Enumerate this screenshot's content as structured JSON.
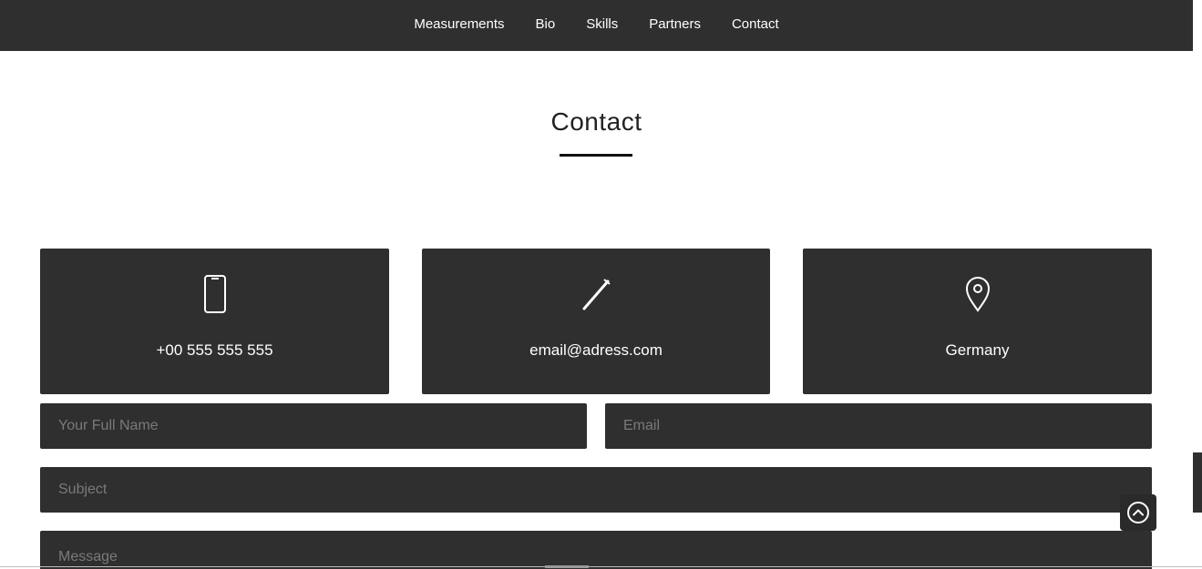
{
  "nav": {
    "items": [
      {
        "label": "Measurements"
      },
      {
        "label": "Bio"
      },
      {
        "label": "Skills"
      },
      {
        "label": "Partners"
      },
      {
        "label": "Contact"
      }
    ]
  },
  "section": {
    "title": "Contact"
  },
  "cards": [
    {
      "icon": "phone-icon",
      "text": "+00 555 555 555"
    },
    {
      "icon": "pencil-icon",
      "text": "email@adress.com"
    },
    {
      "icon": "map-pin-icon",
      "text": "Germany"
    }
  ],
  "form": {
    "name_placeholder": "Your Full Name",
    "email_placeholder": "Email",
    "subject_placeholder": "Subject",
    "message_placeholder": "Message"
  },
  "back_to_top": {
    "icon": "chevron-up-circle-icon"
  },
  "colors": {
    "dark": "#2f2f2f",
    "text_light": "#ffffff",
    "placeholder": "#7a7a7a"
  }
}
